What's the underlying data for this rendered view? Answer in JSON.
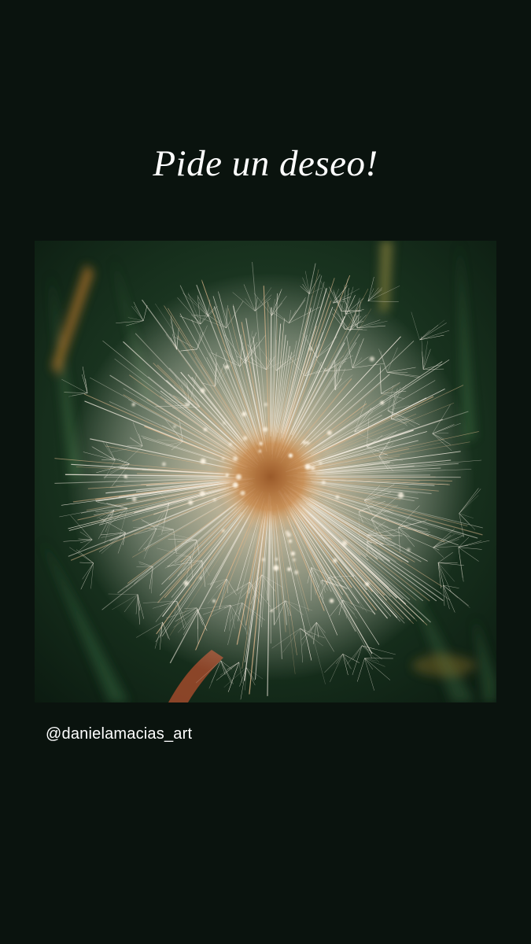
{
  "story": {
    "title": "Pide un deseo!",
    "mention": "@danielamacias_art",
    "background_color": "#0a130e",
    "text_color": "#ffffff"
  },
  "photo": {
    "subject": "dandelion-seed-head",
    "palette": {
      "foliage_dark": "#0d2014",
      "foliage_mid": "#2f5a36",
      "fluff": "#f3ece0",
      "core": "#b9763a",
      "stem": "#a04a2c",
      "dry_leaf": "#c07a2a"
    }
  }
}
